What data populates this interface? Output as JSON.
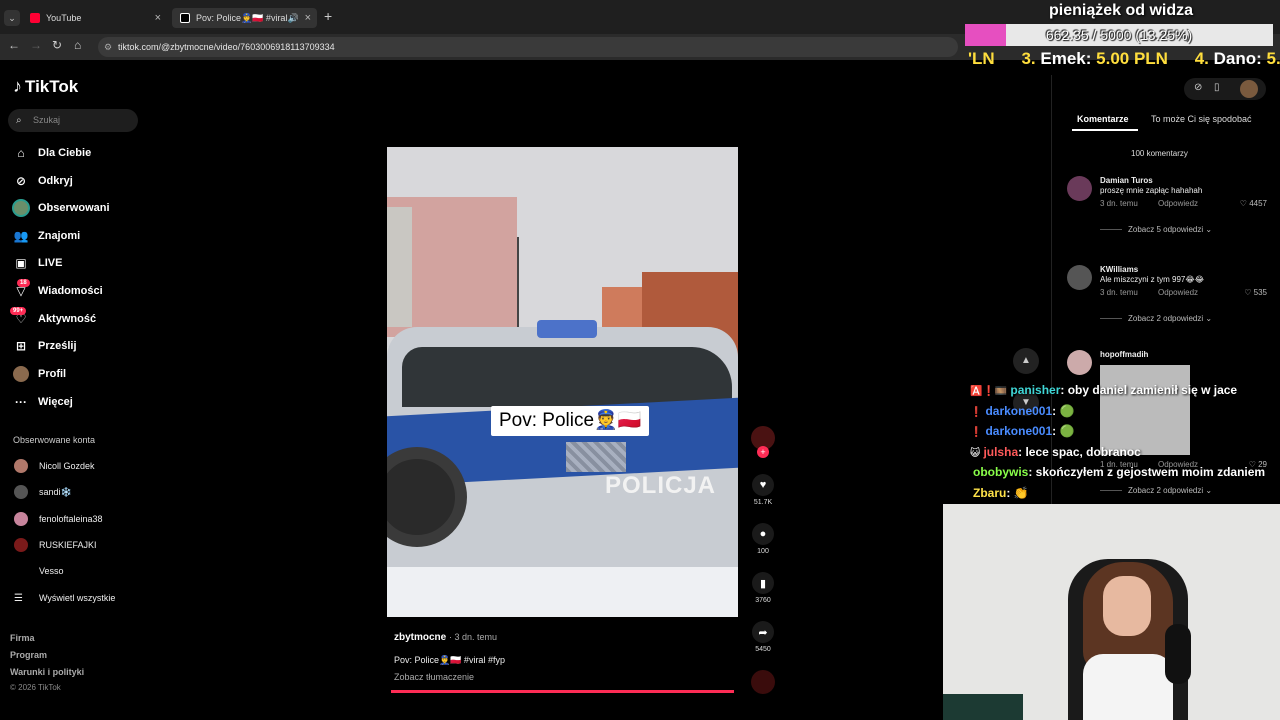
{
  "browser": {
    "tabs": [
      {
        "title": "YouTube",
        "close": "×"
      },
      {
        "title": "Pov: Police👮🇵🇱 #viral #fyp",
        "close": "×"
      }
    ],
    "url": "tiktok.com/@zbytmocne/video/7603006918113709334"
  },
  "sidebar": {
    "logo": "TikTok",
    "search_placeholder": "Szukaj",
    "nav": [
      {
        "label": "Dla Ciebie",
        "icon": "home-icon"
      },
      {
        "label": "Odkryj",
        "icon": "compass-icon"
      },
      {
        "label": "Obserwowani",
        "icon": "following-avatar"
      },
      {
        "label": "Znajomi",
        "icon": "friends-icon"
      },
      {
        "label": "LIVE",
        "icon": "live-icon"
      },
      {
        "label": "Wiadomości",
        "icon": "inbox-icon",
        "badge": "18"
      },
      {
        "label": "Aktywność",
        "icon": "activity-icon",
        "badge": "99+"
      },
      {
        "label": "Prześlij",
        "icon": "upload-icon"
      },
      {
        "label": "Profil",
        "icon": "profile-avatar"
      },
      {
        "label": "Więcej",
        "icon": "more-icon"
      }
    ],
    "following_title": "Obserwowane konta",
    "following": [
      {
        "name": "Nicoll Gozdek"
      },
      {
        "name": "sandi❄️"
      },
      {
        "name": "fenoloftaleina38"
      },
      {
        "name": "RUSKIEFAJKI"
      },
      {
        "name": "Vesso"
      }
    ],
    "see_all": "Wyświetl wszystkie",
    "footer": [
      "Firma",
      "Program",
      "Warunki i polityki"
    ],
    "copyright": "© 2026 TikTok"
  },
  "video": {
    "caption_overlay": "Pov: Police👮🇵🇱",
    "car_text": "POLICJA",
    "author": "zbytmocne",
    "posted": "· 3 dn. temu",
    "description": "Pov: Police👮‍♂️🇵🇱 #viral #fyp",
    "translate": "Zobacz tłumaczenie",
    "progress": 1.0,
    "actions": {
      "likes": "51.7K",
      "comments": "100",
      "saves": "3760",
      "shares": "5450"
    }
  },
  "comments_panel": {
    "tab_comments": "Komentarze",
    "tab_like": "To może Ci się spodobać",
    "count": "100 komentarzy",
    "comments": [
      {
        "user": "Damian Turos",
        "text": "proszę mnie zapłąc hahahah",
        "date": "3 dn. temu",
        "reply": "Odpowiedz",
        "likes": "4457",
        "more": "Zobacz 5 odpowiedzi"
      },
      {
        "user": "KWilliams",
        "text": "Ale miszczyni z tym 997😂😂",
        "date": "3 dn. temu",
        "reply": "Odpowiedz",
        "likes": "535",
        "more": "Zobacz 2 odpowiedzi"
      },
      {
        "user": "hopoffmadih",
        "text": "",
        "date": "1 dn. temu",
        "reply": "Odpowiedz",
        "likes": "29",
        "more": "Zobacz 2 odpowiedzi"
      }
    ]
  },
  "overlay": {
    "donation_title": "pieniążek od widza",
    "donation_progress": "662.35 / 5000 (13.25%)",
    "donation_fraction": 0.1325,
    "ticker": [
      {
        "rank": "",
        "name": "'LN",
        "amount": ""
      },
      {
        "rank": "3.",
        "name": "Emek:",
        "amount": "5.00 PLN"
      },
      {
        "rank": "4.",
        "name": "Dano:",
        "amount": "5.00"
      }
    ],
    "chat": [
      {
        "badges": "🅰️❗🎞️",
        "user": "panisher",
        "color": "#3fd6d6",
        "msg": ": oby daniel zamienił się w jace"
      },
      {
        "badges": "❗",
        "user": "darkone001",
        "color": "#4a8cff",
        "msg": ": 🟢"
      },
      {
        "badges": "❗",
        "user": "darkone001",
        "color": "#4a8cff",
        "msg": ": 🟢"
      },
      {
        "badges": "😺",
        "user": "julsha",
        "color": "#ff5a5a",
        "msg": ": lece spac, dobranoc"
      },
      {
        "badges": "",
        "user": "obobywis",
        "color": "#8aff4a",
        "msg": ": skończyłem z gejostwem moim zdaniem"
      },
      {
        "badges": "",
        "user": "Zbaru",
        "color": "#ffe34a",
        "msg": ": 👏"
      }
    ]
  },
  "colors": {
    "tiktok_red": "#fe2c55",
    "donation_fill": "#e64fc0"
  }
}
